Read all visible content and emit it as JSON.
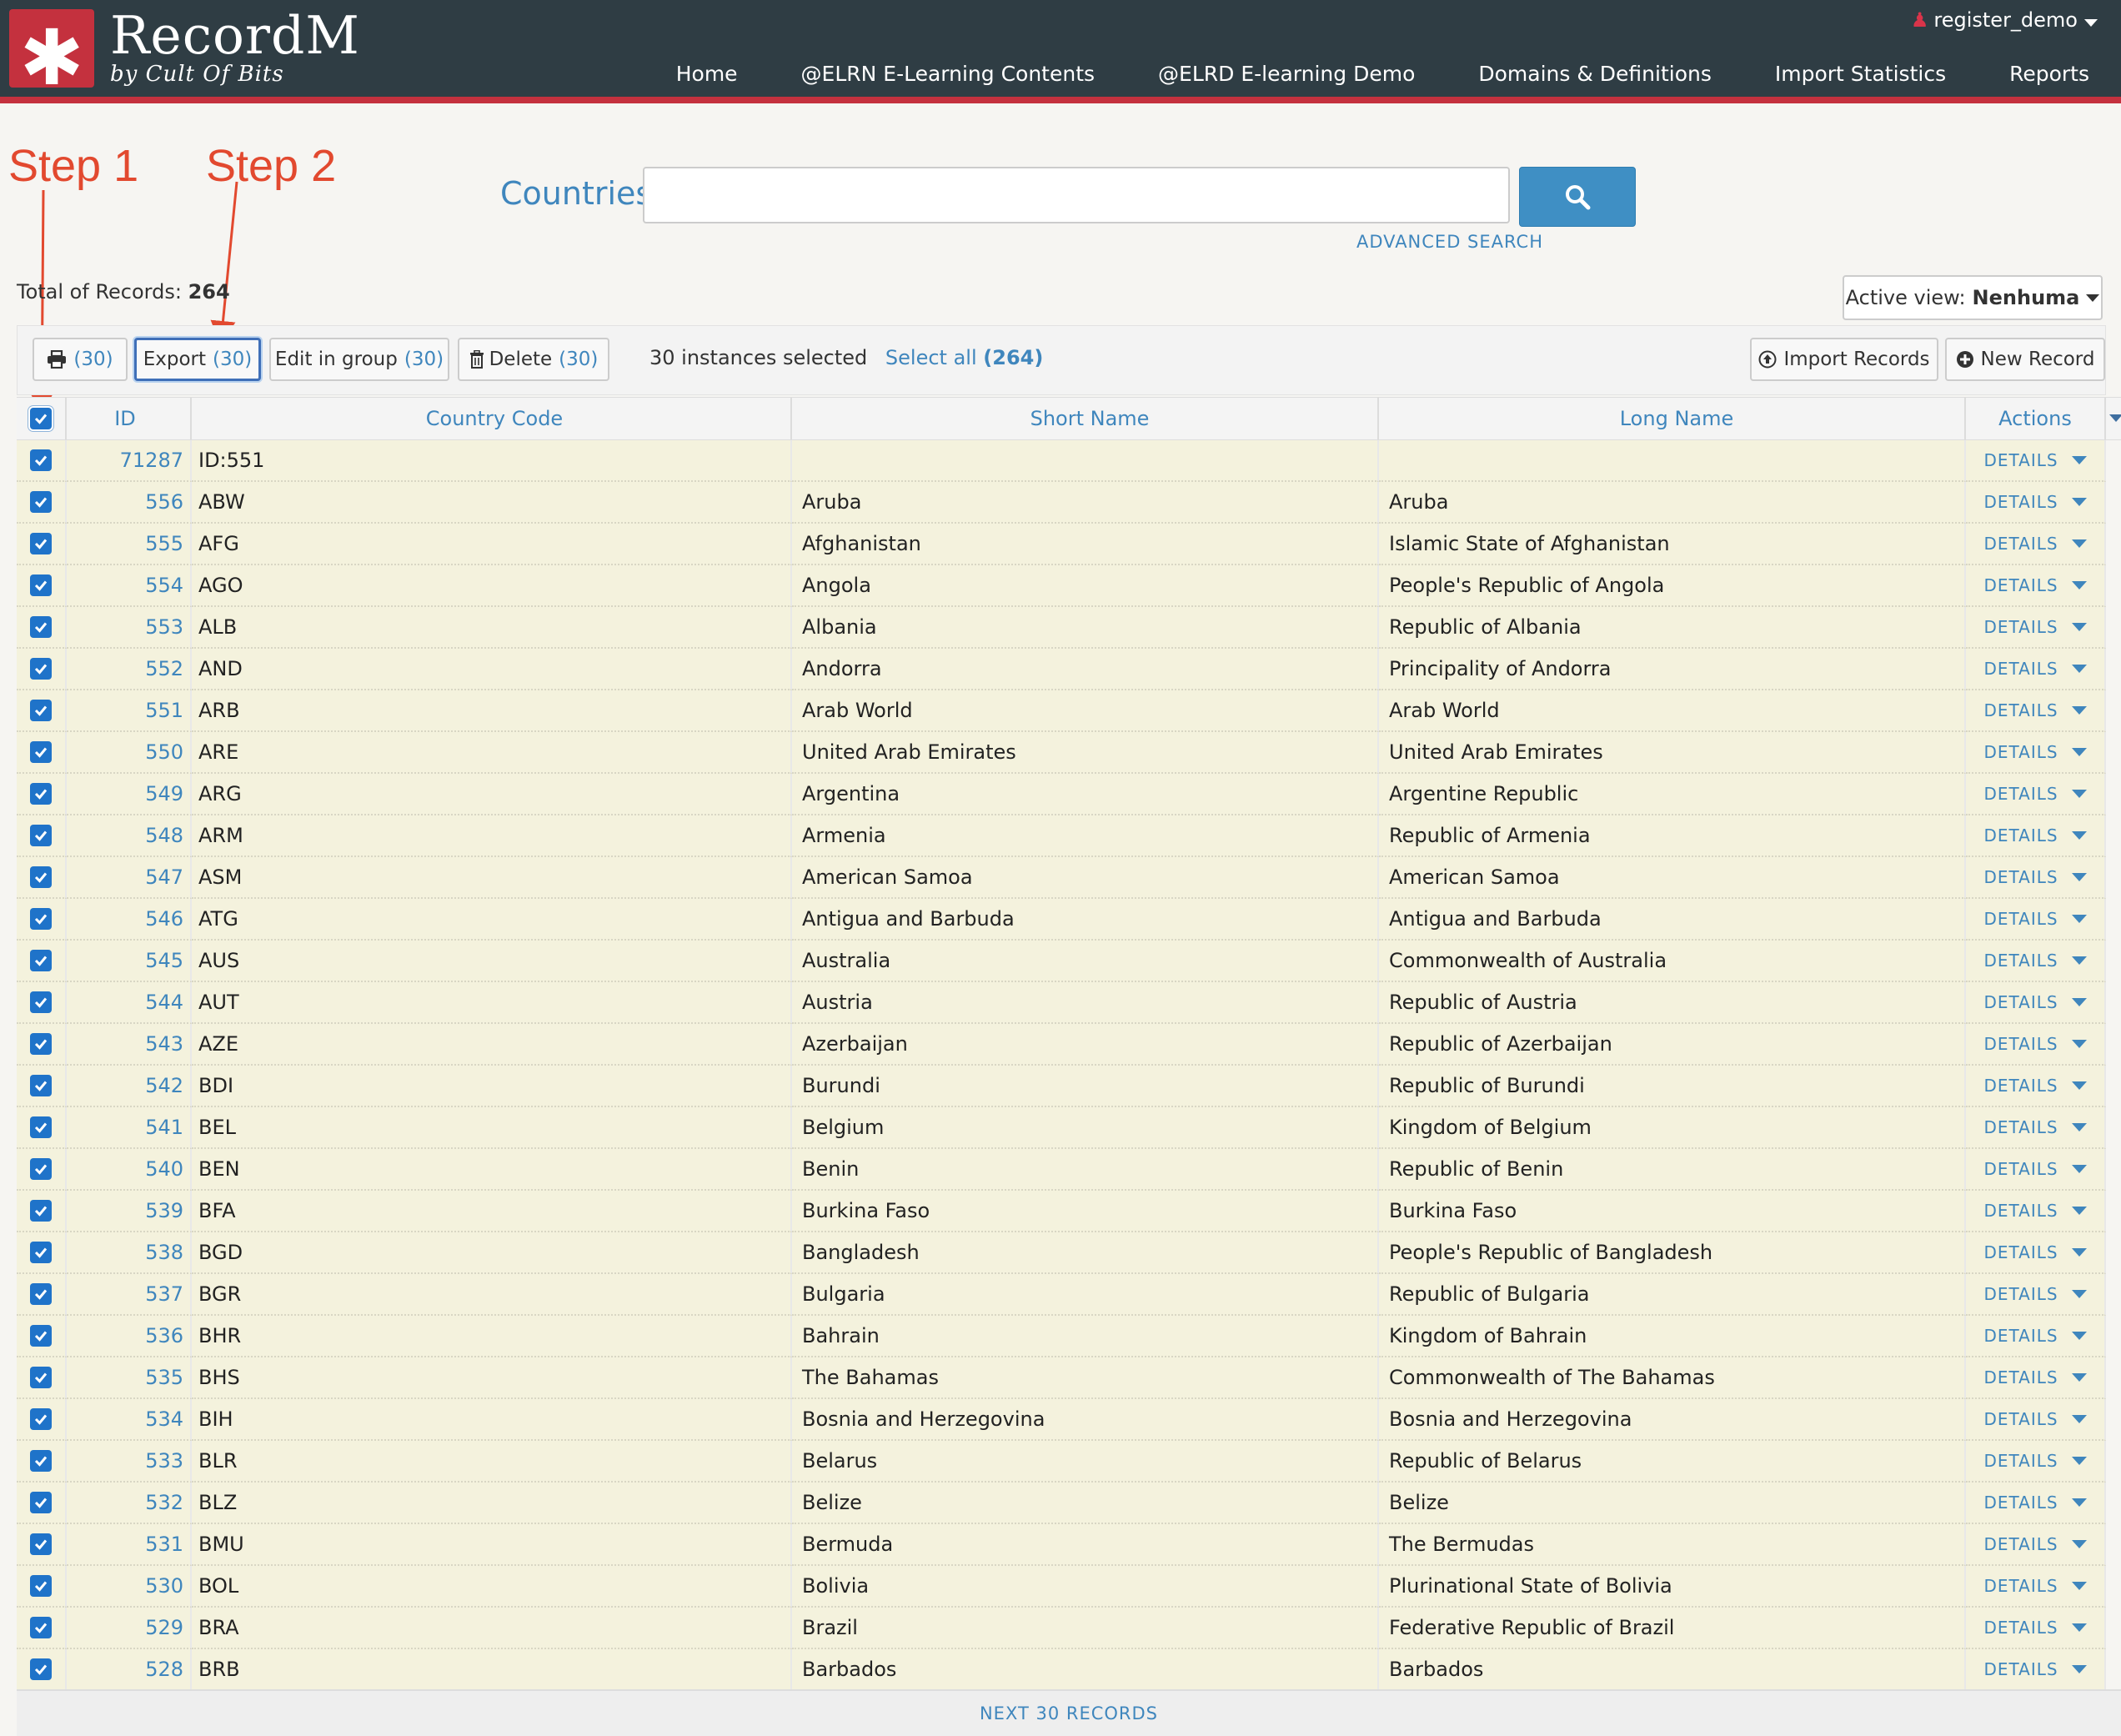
{
  "app": {
    "logo_glyph": "✱",
    "title": "RecordM",
    "subtitle": "by Cult Of Bits",
    "user": "register_demo",
    "accent_color": "#c4313e",
    "header_color": "#2f3d44"
  },
  "nav": [
    "Home",
    "@ELRN E-Learning Contents",
    "@ELRD E-learning Demo",
    "Domains & Definitions",
    "Import Statistics",
    "Reports"
  ],
  "annotations": {
    "step1": "Step 1",
    "step2": "Step 2"
  },
  "search": {
    "label": "Countries",
    "value": "",
    "advanced": "ADVANCED SEARCH"
  },
  "total": {
    "label": "Total of Records:",
    "count": "264"
  },
  "active_view": {
    "label": "Active view:",
    "value": "Nenhuma"
  },
  "toolbar": {
    "print_count": "(30)",
    "export_label": "Export",
    "export_count": "(30)",
    "edit_label": "Edit in group",
    "edit_count": "(30)",
    "delete_label": "Delete",
    "delete_count": "(30)",
    "selected_text": "30 instances selected",
    "select_all_label": "Select all",
    "select_all_count": "(264)",
    "import_label": "Import Records",
    "new_label": "New Record"
  },
  "columns": [
    "ID",
    "Country Code",
    "Short Name",
    "Long Name",
    "Actions"
  ],
  "details_label": "DETAILS",
  "rows": [
    {
      "id": "71287",
      "code": "ID:551",
      "short": "",
      "long": ""
    },
    {
      "id": "556",
      "code": "ABW",
      "short": "Aruba",
      "long": "Aruba"
    },
    {
      "id": "555",
      "code": "AFG",
      "short": "Afghanistan",
      "long": "Islamic State of Afghanistan"
    },
    {
      "id": "554",
      "code": "AGO",
      "short": "Angola",
      "long": "People's Republic of Angola"
    },
    {
      "id": "553",
      "code": "ALB",
      "short": "Albania",
      "long": "Republic of Albania"
    },
    {
      "id": "552",
      "code": "AND",
      "short": "Andorra",
      "long": "Principality of Andorra"
    },
    {
      "id": "551",
      "code": "ARB",
      "short": "Arab World",
      "long": "Arab World"
    },
    {
      "id": "550",
      "code": "ARE",
      "short": "United Arab Emirates",
      "long": "United Arab Emirates"
    },
    {
      "id": "549",
      "code": "ARG",
      "short": "Argentina",
      "long": "Argentine Republic"
    },
    {
      "id": "548",
      "code": "ARM",
      "short": "Armenia",
      "long": "Republic of Armenia"
    },
    {
      "id": "547",
      "code": "ASM",
      "short": "American Samoa",
      "long": "American Samoa"
    },
    {
      "id": "546",
      "code": "ATG",
      "short": "Antigua and Barbuda",
      "long": "Antigua and Barbuda"
    },
    {
      "id": "545",
      "code": "AUS",
      "short": "Australia",
      "long": "Commonwealth of Australia"
    },
    {
      "id": "544",
      "code": "AUT",
      "short": "Austria",
      "long": "Republic of Austria"
    },
    {
      "id": "543",
      "code": "AZE",
      "short": "Azerbaijan",
      "long": "Republic of Azerbaijan"
    },
    {
      "id": "542",
      "code": "BDI",
      "short": "Burundi",
      "long": "Republic of Burundi"
    },
    {
      "id": "541",
      "code": "BEL",
      "short": "Belgium",
      "long": "Kingdom of Belgium"
    },
    {
      "id": "540",
      "code": "BEN",
      "short": "Benin",
      "long": "Republic of Benin"
    },
    {
      "id": "539",
      "code": "BFA",
      "short": "Burkina Faso",
      "long": "Burkina Faso"
    },
    {
      "id": "538",
      "code": "BGD",
      "short": "Bangladesh",
      "long": "People's Republic of Bangladesh"
    },
    {
      "id": "537",
      "code": "BGR",
      "short": "Bulgaria",
      "long": "Republic of Bulgaria"
    },
    {
      "id": "536",
      "code": "BHR",
      "short": "Bahrain",
      "long": "Kingdom of Bahrain"
    },
    {
      "id": "535",
      "code": "BHS",
      "short": "The Bahamas",
      "long": "Commonwealth of The Bahamas"
    },
    {
      "id": "534",
      "code": "BIH",
      "short": "Bosnia and Herzegovina",
      "long": "Bosnia and Herzegovina"
    },
    {
      "id": "533",
      "code": "BLR",
      "short": "Belarus",
      "long": "Republic of Belarus"
    },
    {
      "id": "532",
      "code": "BLZ",
      "short": "Belize",
      "long": "Belize"
    },
    {
      "id": "531",
      "code": "BMU",
      "short": "Bermuda",
      "long": "The Bermudas"
    },
    {
      "id": "530",
      "code": "BOL",
      "short": "Bolivia",
      "long": "Plurinational State of Bolivia"
    },
    {
      "id": "529",
      "code": "BRA",
      "short": "Brazil",
      "long": "Federative Republic of Brazil"
    },
    {
      "id": "528",
      "code": "BRB",
      "short": "Barbados",
      "long": "Barbados"
    }
  ],
  "next_label": "NEXT 30 RECORDS"
}
